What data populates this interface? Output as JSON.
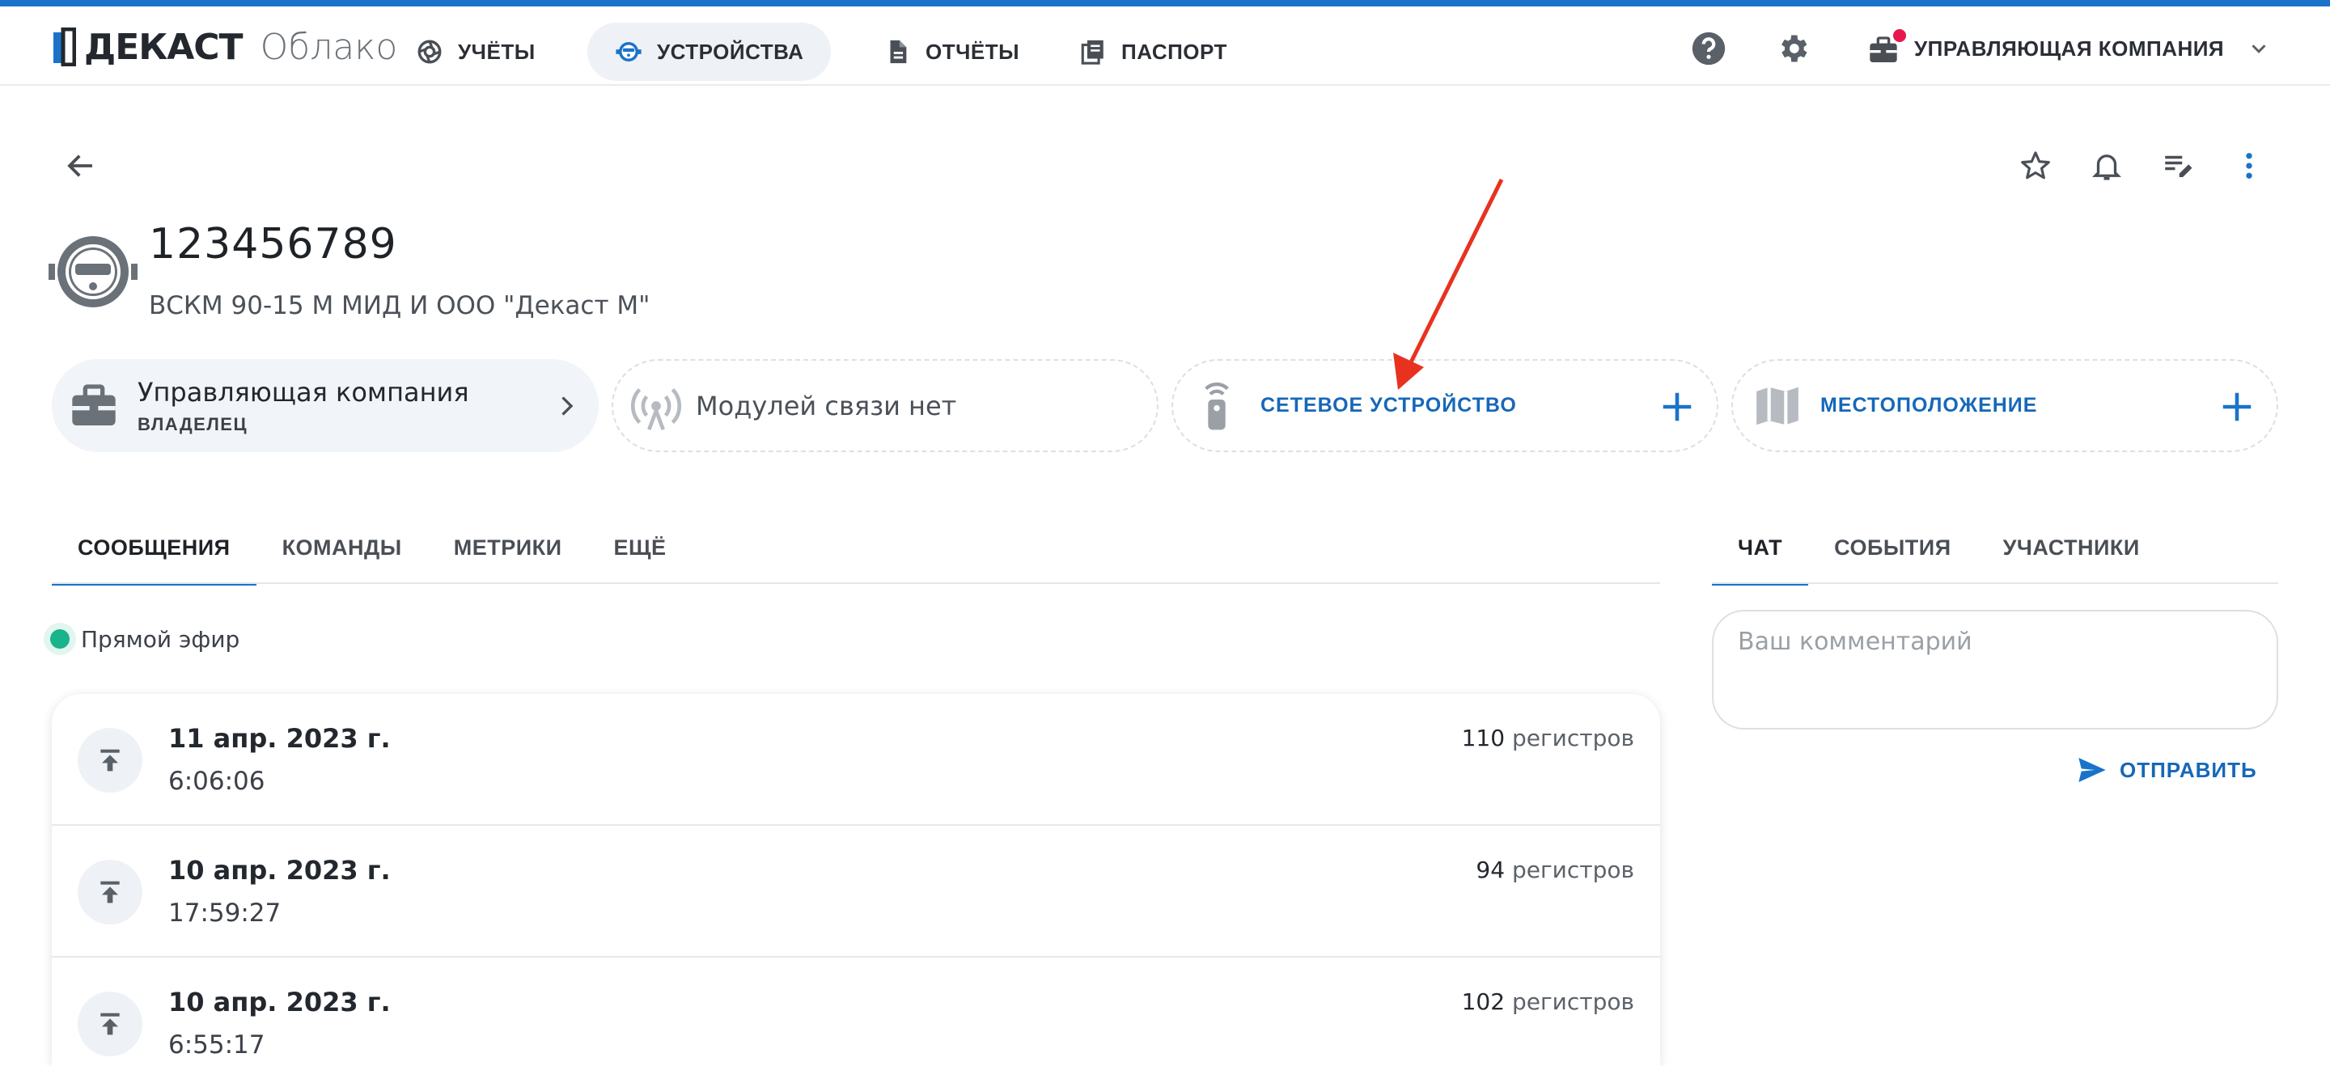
{
  "brand": {
    "name": "ДЕКАСТ",
    "product": "Облако"
  },
  "nav": {
    "items": [
      {
        "label": "УЧЁТЫ",
        "icon": "aperture-icon",
        "active": false
      },
      {
        "label": "УСТРОЙСТВА",
        "icon": "meter-icon",
        "active": true
      },
      {
        "label": "ОТЧЁТЫ",
        "icon": "document-icon",
        "active": false
      },
      {
        "label": "ПАСПОРТ",
        "icon": "library-icon",
        "active": false
      }
    ],
    "help_icon": "help-icon",
    "settings_icon": "gear-icon",
    "company_label": "УПРАВЛЯЮЩАЯ КОМПАНИЯ",
    "company_icon": "briefcase-icon",
    "notification_color": "#e8174d"
  },
  "device": {
    "title": "123456789",
    "subtitle": "ВСКМ 90-15 М МИД И ООО \"Декаст М\""
  },
  "cards": {
    "owner": {
      "title": "Управляющая компания",
      "subtitle": "ВЛАДЕЛЕЦ"
    },
    "modules": {
      "text": "Модулей связи нет"
    },
    "network": {
      "label": "СЕТЕВОЕ УСТРОЙСТВО"
    },
    "location": {
      "label": "МЕСТОПОЛОЖЕНИЕ"
    }
  },
  "tabs": [
    "СООБЩЕНИЯ",
    "КОМАНДЫ",
    "МЕТРИКИ",
    "ЕЩЁ"
  ],
  "live": {
    "label": "Прямой эфир",
    "color": "#19b38c"
  },
  "messages": [
    {
      "date": "11 апр. 2023 г.",
      "time": "6:06:06",
      "count": "110",
      "unit": "регистров"
    },
    {
      "date": "10 апр. 2023 г.",
      "time": "17:59:27",
      "count": "94",
      "unit": "регистров"
    },
    {
      "date": "10 апр. 2023 г.",
      "time": "6:55:17",
      "count": "102",
      "unit": "регистров"
    }
  ],
  "chat": {
    "tabs": [
      "ЧАТ",
      "СОБЫТИЯ",
      "УЧАСТНИКИ"
    ],
    "placeholder": "Ваш комментарий",
    "send_label": "ОТПРАВИТЬ"
  },
  "colors": {
    "accent": "#1a73c9",
    "link": "#1668b8",
    "annotation_arrow": "#e8321f"
  }
}
